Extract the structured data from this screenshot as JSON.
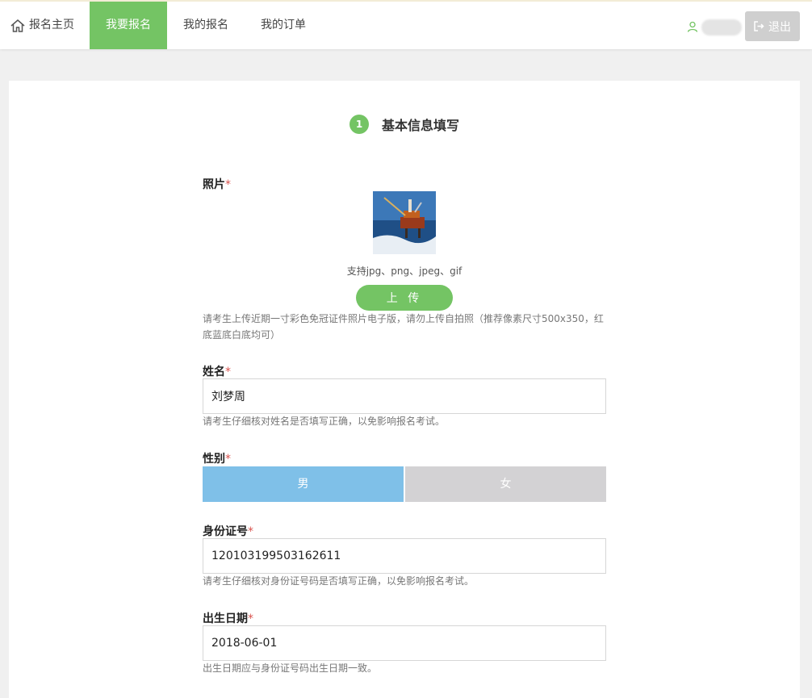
{
  "nav": {
    "home": "报名主页",
    "apply": "我要报名",
    "my_applications": "我的报名",
    "my_orders": "我的订单",
    "logout": "退出"
  },
  "step": {
    "number": "1",
    "title": "基本信息填写"
  },
  "photo": {
    "label": "照片",
    "required_mark": "*",
    "support": "支持jpg、png、jpeg、gif",
    "upload_label": "上 传",
    "hint": "请考生上传近期一寸彩色免冠证件照片电子版，请勿上传自拍照（推荐像素尺寸500x350，红底蓝底白底均可）"
  },
  "name": {
    "label": "姓名",
    "required_mark": "*",
    "value": "刘梦周",
    "hint": "请考生仔细核对姓名是否填写正确，以免影响报名考试。"
  },
  "gender": {
    "label": "性别",
    "required_mark": "*",
    "male": "男",
    "female": "女",
    "selected": "男"
  },
  "id_number": {
    "label": "身份证号",
    "required_mark": "*",
    "value": "120103199503162611",
    "hint": "请考生仔细核对身份证号码是否填写正确，以免影响报名考试。"
  },
  "birth_date": {
    "label": "出生日期",
    "required_mark": "*",
    "value": "2018-06-01",
    "hint": "出生日期应与身份证号码出生日期一致。"
  },
  "colors": {
    "accent_green": "#74c464",
    "selected_blue": "#7fc0e8",
    "unselected_gray": "#d3d2d4",
    "required_red": "#d9534f"
  }
}
